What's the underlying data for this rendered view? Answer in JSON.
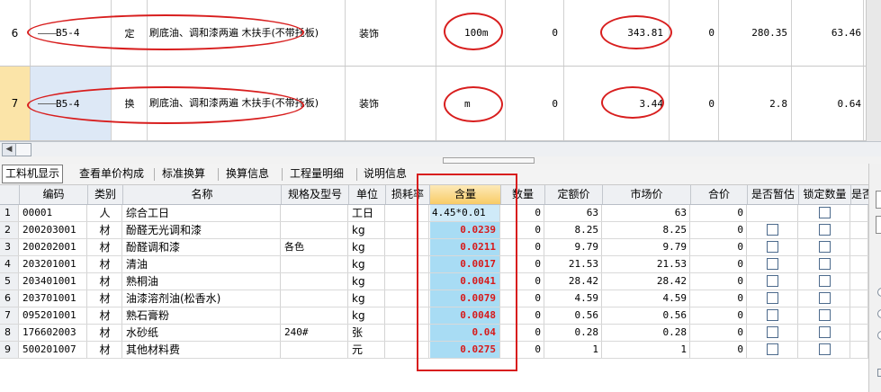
{
  "upper_rows": [
    {
      "row_num": "6",
      "code": "B5-4",
      "type": "定",
      "name": "刷底油、调和漆两遍 木扶手(不带托板)",
      "spec": "装饰",
      "unit": "100m",
      "c1": "0",
      "c2": "343.81",
      "c3": "0",
      "c4": "280.35",
      "c5": "63.46"
    },
    {
      "row_num": "7",
      "code": "B5-4",
      "type": "换",
      "name": "刷底油、调和漆两遍 木扶手(不带托板)",
      "spec": "装饰",
      "unit": "m",
      "c1": "0",
      "c2": "3.44",
      "c3": "0",
      "c4": "2.8",
      "c5": "0.64"
    }
  ],
  "tabs": [
    "工料机显示",
    "查看单价构成",
    "标准换算",
    "换算信息",
    "工程量明细",
    "说明信息"
  ],
  "active_tab": 0,
  "columns": [
    "编码",
    "类别",
    "名称",
    "规格及型号",
    "单位",
    "损耗率",
    "含量",
    "数量",
    "定额价",
    "市场价",
    "合价",
    "是否暂估",
    "锁定数量",
    "是否"
  ],
  "rows": [
    {
      "n": "1",
      "code": "00001",
      "cat": "人",
      "name": "综合工日",
      "spec": "",
      "unit": "工日",
      "loss": "",
      "qty": "4.45*0.01",
      "num": "0",
      "quota": "63",
      "market": "63",
      "total": "0",
      "est": false,
      "lock": true
    },
    {
      "n": "2",
      "code": "200203001",
      "cat": "材",
      "name": "酚醛无光调和漆",
      "spec": "",
      "unit": "kg",
      "loss": "",
      "qty": "0.0239",
      "num": "0",
      "quota": "8.25",
      "market": "8.25",
      "total": "0",
      "est": true,
      "lock": true
    },
    {
      "n": "3",
      "code": "200202001",
      "cat": "材",
      "name": "酚醛调和漆",
      "spec": "各色",
      "unit": "kg",
      "loss": "",
      "qty": "0.0211",
      "num": "0",
      "quota": "9.79",
      "market": "9.79",
      "total": "0",
      "est": true,
      "lock": true
    },
    {
      "n": "4",
      "code": "203201001",
      "cat": "材",
      "name": "清油",
      "spec": "",
      "unit": "kg",
      "loss": "",
      "qty": "0.0017",
      "num": "0",
      "quota": "21.53",
      "market": "21.53",
      "total": "0",
      "est": true,
      "lock": true
    },
    {
      "n": "5",
      "code": "203401001",
      "cat": "材",
      "name": "熟桐油",
      "spec": "",
      "unit": "kg",
      "loss": "",
      "qty": "0.0041",
      "num": "0",
      "quota": "28.42",
      "market": "28.42",
      "total": "0",
      "est": true,
      "lock": true
    },
    {
      "n": "6",
      "code": "203701001",
      "cat": "材",
      "name": "油漆溶剂油(松香水)",
      "spec": "",
      "unit": "kg",
      "loss": "",
      "qty": "0.0079",
      "num": "0",
      "quota": "4.59",
      "market": "4.59",
      "total": "0",
      "est": true,
      "lock": true
    },
    {
      "n": "7",
      "code": "095201001",
      "cat": "材",
      "name": "熟石膏粉",
      "spec": "",
      "unit": "kg",
      "loss": "",
      "qty": "0.0048",
      "num": "0",
      "quota": "0.56",
      "market": "0.56",
      "total": "0",
      "est": true,
      "lock": true
    },
    {
      "n": "8",
      "code": "176602003",
      "cat": "材",
      "name": "水砂纸",
      "spec": "240#",
      "unit": "张",
      "loss": "",
      "qty": "0.04",
      "num": "0",
      "quota": "0.28",
      "market": "0.28",
      "total": "0",
      "est": true,
      "lock": true
    },
    {
      "n": "9",
      "code": "500201007",
      "cat": "材",
      "name": "其他材料费",
      "spec": "",
      "unit": "元",
      "loss": "",
      "qty": "0.0275",
      "num": "0",
      "quota": "1",
      "market": "1",
      "total": "0",
      "est": true,
      "lock": true
    }
  ]
}
